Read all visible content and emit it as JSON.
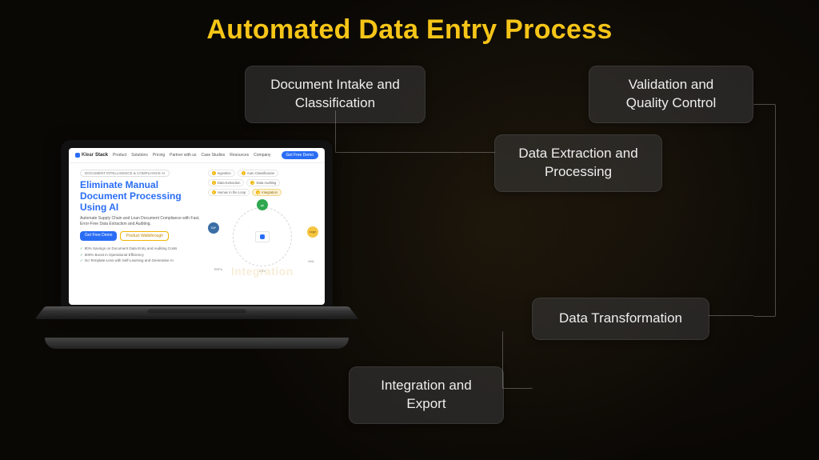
{
  "title": "Automated Data Entry Process",
  "process": {
    "step1": "Document Intake and Classification",
    "step2": "Validation and Quality Control",
    "step3": "Data Extraction and Processing",
    "step4": "Data Transformation",
    "step5": "Integration and Export"
  },
  "laptop_site": {
    "brand_first": "Klear",
    "brand_second": "Stack",
    "nav": {
      "product": "Product",
      "solutions": "Solutions",
      "pricing": "Pricing",
      "partner": "Partner with us",
      "case_studies": "Case Studies",
      "resources": "Resources",
      "company": "Company",
      "cta": "Get Free Demo"
    },
    "eyebrow": "DOCUMENT INTELLIGENCE & COMPLIANCE AI",
    "headline": "Eliminate Manual Document Processing Using AI",
    "subcopy": "Automate Supply Chain and Loan Document Compliance with Fast, Error-Free Data Extraction and Auditing.",
    "cta_primary": "Get Free Demo",
    "cta_secondary": "Product Walkthrough",
    "bullets": {
      "b1": "80% Savings on Document Data Entry and Auditing Costs",
      "b2": "500% Boost in Operational Efficiency",
      "b3": "Go Template-Less with Self-Learning and Generative AI"
    },
    "pills": {
      "p1": "Ingestion",
      "p2": "Auto Classification",
      "p3": "Data Extraction",
      "p4": "Data Auditing",
      "p5": "Human in the Loop",
      "p6": "Integration"
    },
    "integrations": {
      "qb": "qb",
      "sap": "SAP",
      "sage": "sage",
      "xml": "XML",
      "csv": "CSV",
      "erps": "ERPs"
    },
    "ghost_word": "Integration"
  }
}
